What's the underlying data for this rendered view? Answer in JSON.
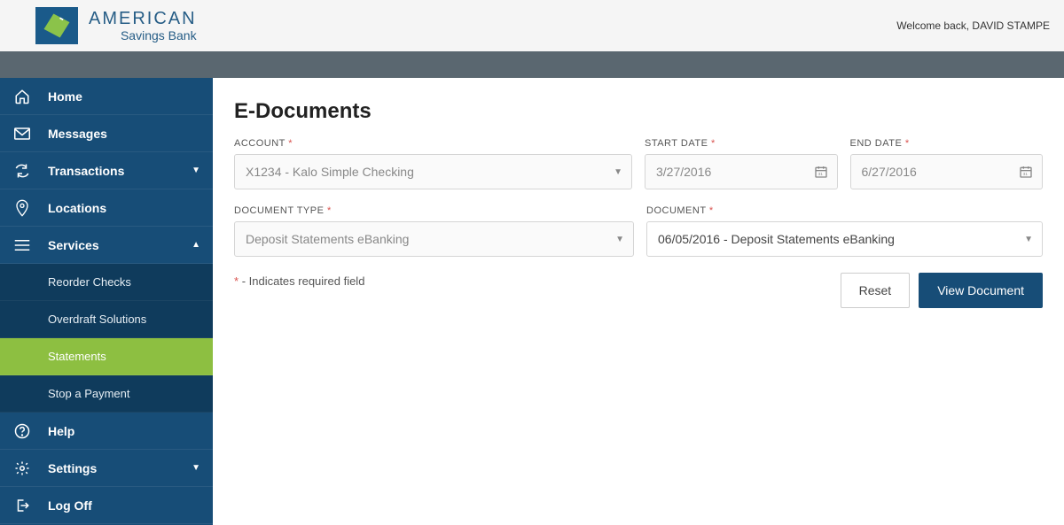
{
  "header": {
    "logo_line1": "AMERICAN",
    "logo_line2": "Savings Bank",
    "welcome": "Welcome back, DAVID STAMPE"
  },
  "sidebar": {
    "items": [
      {
        "label": "Home"
      },
      {
        "label": "Messages"
      },
      {
        "label": "Transactions"
      },
      {
        "label": "Locations"
      },
      {
        "label": "Services"
      }
    ],
    "services_sub": [
      {
        "label": "Reorder Checks"
      },
      {
        "label": "Overdraft Solutions"
      },
      {
        "label": "Statements"
      },
      {
        "label": "Stop a Payment"
      }
    ],
    "bottom": [
      {
        "label": "Help"
      },
      {
        "label": "Settings"
      },
      {
        "label": "Log Off"
      }
    ]
  },
  "page": {
    "title": "E-Documents",
    "labels": {
      "account": "ACCOUNT",
      "start_date": "START DATE",
      "end_date": "END DATE",
      "doc_type": "DOCUMENT TYPE",
      "document": "DOCUMENT"
    },
    "values": {
      "account": "X1234 - Kalo Simple Checking",
      "start_date": "3/27/2016",
      "end_date": "6/27/2016",
      "doc_type": "Deposit Statements eBanking",
      "document": "06/05/2016 - Deposit Statements eBanking"
    },
    "footnote": "- Indicates required field",
    "req_marker": "*",
    "buttons": {
      "reset": "Reset",
      "view": "View Document"
    }
  }
}
